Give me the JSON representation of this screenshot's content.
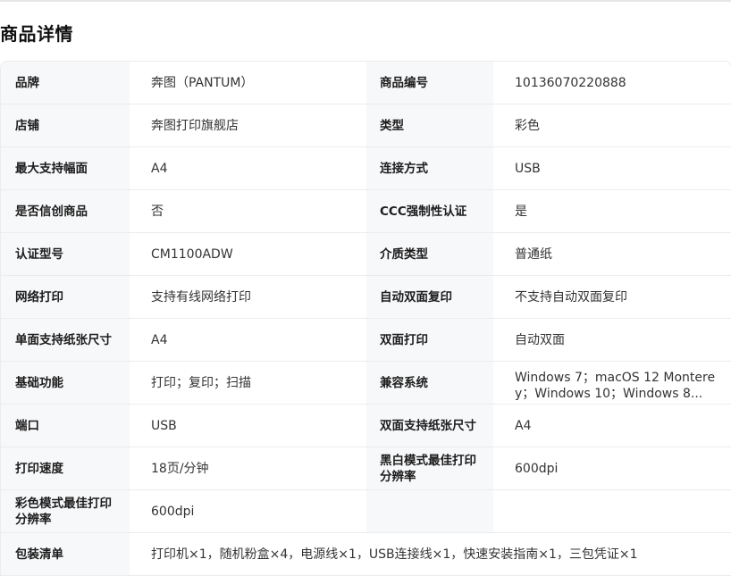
{
  "page": {
    "title": "商品详情"
  },
  "specs": [
    {
      "k1": "品牌",
      "v1": "奔图（PANTUM）",
      "k2": "商品编号",
      "v2": "10136070220888"
    },
    {
      "k1": "店铺",
      "v1": "奔图打印旗舰店",
      "k2": "类型",
      "v2": "彩色"
    },
    {
      "k1": "最大支持幅面",
      "v1": "A4",
      "k2": "连接方式",
      "v2": "USB"
    },
    {
      "k1": "是否信创商品",
      "v1": "否",
      "k2": "CCC强制性认证",
      "v2": "是"
    },
    {
      "k1": "认证型号",
      "v1": "CM1100ADW",
      "k2": "介质类型",
      "v2": "普通纸"
    },
    {
      "k1": "网络打印",
      "v1": "支持有线网络打印",
      "k2": "自动双面复印",
      "v2": "不支持自动双面复印"
    },
    {
      "k1": "单面支持纸张尺寸",
      "v1": "A4",
      "k2": "双面打印",
      "v2": "自动双面"
    },
    {
      "k1": "基础功能",
      "v1": "打印；复印；扫描",
      "k2": "兼容系统",
      "v2": "Windows 7；macOS 12 Monterey；Windows 10；Windows 8..."
    },
    {
      "k1": "端口",
      "v1": "USB",
      "k2": "双面支持纸张尺寸",
      "v2": "A4"
    },
    {
      "k1": "打印速度",
      "v1": "18页/分钟",
      "k2": "黑白模式最佳打印分辨率",
      "v2": "600dpi"
    },
    {
      "k1": "彩色模式最佳打印分辨率",
      "v1": "600dpi",
      "k2": "",
      "v2": ""
    }
  ],
  "package": {
    "label": "包装清单",
    "value": "打印机×1，随机粉盒×4，电源线×1，USB连接线×1，快速安装指南×1，三包凭证×1"
  }
}
